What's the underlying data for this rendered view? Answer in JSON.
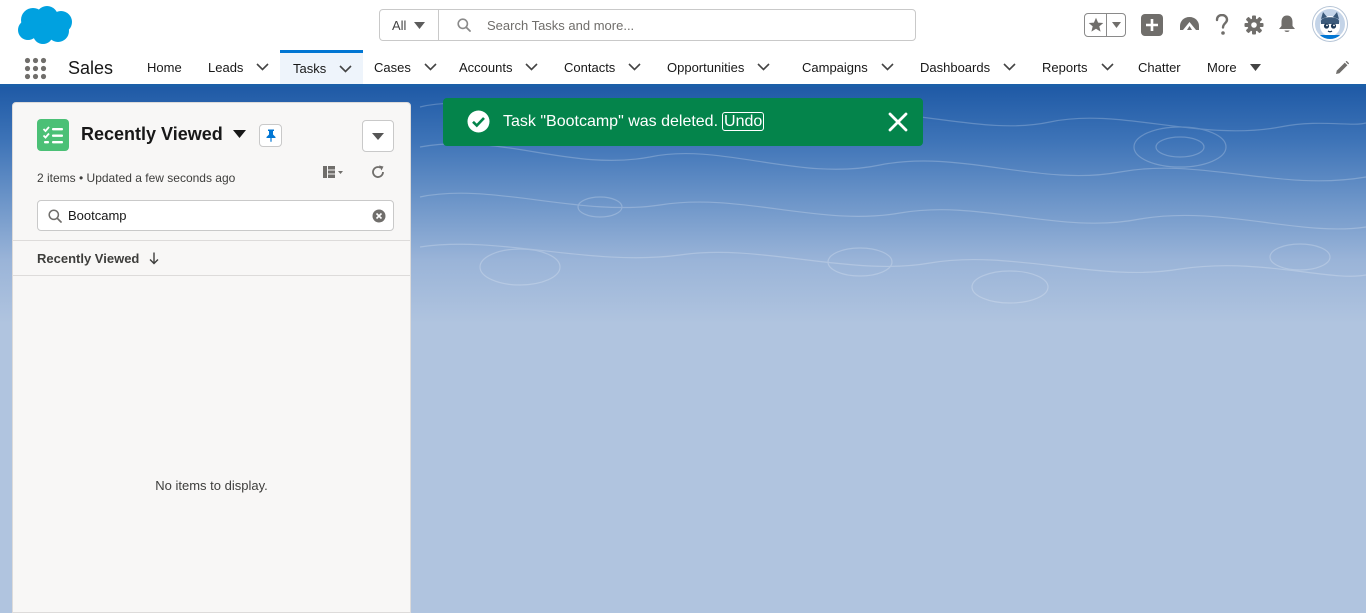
{
  "app": {
    "name": "Sales"
  },
  "search": {
    "scope": "All",
    "placeholder": "Search Tasks and more..."
  },
  "header_icons": [
    "favorites-star-icon",
    "add-icon",
    "trailhead-icon",
    "help-icon",
    "setup-gear-icon",
    "notifications-bell-icon",
    "avatar"
  ],
  "nav": {
    "items": [
      {
        "label": "Home",
        "has_menu": false
      },
      {
        "label": "Leads",
        "has_menu": true
      },
      {
        "label": "Tasks",
        "has_menu": true,
        "active": true
      },
      {
        "label": "Cases",
        "has_menu": true
      },
      {
        "label": "Accounts",
        "has_menu": true
      },
      {
        "label": "Contacts",
        "has_menu": true
      },
      {
        "label": "Opportunities",
        "has_menu": true
      },
      {
        "label": "Campaigns",
        "has_menu": true
      },
      {
        "label": "Dashboards",
        "has_menu": true
      },
      {
        "label": "Reports",
        "has_menu": true
      },
      {
        "label": "Chatter",
        "has_menu": false
      },
      {
        "label": "More",
        "has_menu": true
      }
    ]
  },
  "list": {
    "title": "Recently Viewed",
    "meta": "2 items • Updated a few seconds ago",
    "search_value": "Bootcamp",
    "column_header": "Recently Viewed",
    "empty_text": "No items to display."
  },
  "toast": {
    "message": "Task \"Bootcamp\" was deleted.",
    "action": "Undo"
  },
  "colors": {
    "brand": "#0176d3",
    "toast_success": "#04844b",
    "task_icon": "#4bc076",
    "background": "#b0c4df"
  }
}
